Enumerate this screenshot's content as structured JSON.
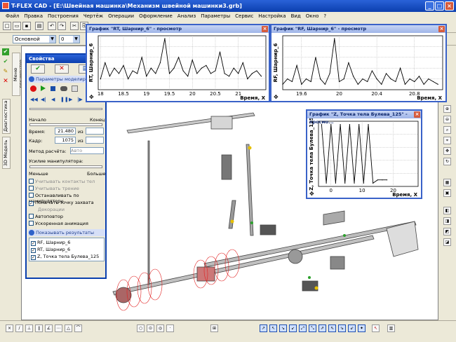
{
  "window": {
    "title": "T-FLEX CAD - [E:\\Швейная машинка\\Механизм швейной машинки3.grb]"
  },
  "menu": [
    "Файл",
    "Правка",
    "Построения",
    "Чертёж",
    "Операции",
    "Оформление",
    "Анализ",
    "Параметры",
    "Сервис",
    "Настройка",
    "Вид",
    "Окно",
    "?"
  ],
  "toolbar": {
    "view_combo": "Основной",
    "number_combo": "0",
    "scale_value": "1"
  },
  "left_tabs": [
    "Меню документов",
    "Диагностика",
    "3D Модель"
  ],
  "properties": {
    "title": "Свойства",
    "section_params": "Параметры моделирования",
    "start_label": "Начало",
    "end_label": "Конец",
    "time_label": "Время:",
    "time_value": "21.480",
    "time_of": "из",
    "frame_label": "Кадр:",
    "frame_value": "1075",
    "frame_of": "из",
    "method_label": "Метод расчёта:",
    "method_value": "Авто",
    "force_label": "Усилие манипулятора:",
    "less_label": "Меньше",
    "more_label": "Больше",
    "options": [
      {
        "label": "Учитывать контакты тел",
        "checked": false,
        "disabled": true
      },
      {
        "label": "Учитывать трение",
        "checked": false,
        "disabled": true
      },
      {
        "label": "Останавливать по манипулятору",
        "checked": false,
        "disabled": false
      },
      {
        "label": "Помечать точку захвата",
        "checked": true,
        "disabled": false
      },
      {
        "label": "Декорации",
        "checked": false,
        "disabled": true,
        "header": true
      },
      {
        "label": "Автоповтор",
        "checked": false,
        "disabled": false
      },
      {
        "label": "Ускоренная анимация",
        "checked": false,
        "disabled": false
      }
    ],
    "section_results": "Показывать результаты",
    "results": [
      {
        "label": "RF, Шарнир_6",
        "checked": true
      },
      {
        "label": "RT, Шарнир_6",
        "checked": true
      },
      {
        "label": "Z, Точка тела Булева_125",
        "checked": true
      }
    ]
  },
  "graphs": [
    {
      "id": "rt",
      "title": "График \"RT, Шарнир_6\" - просмотр",
      "ylabel": "RT, Шарнир_6",
      "xlabel": "Время, Х",
      "ticks": [
        "18",
        "18.5",
        "19",
        "19.5",
        "20",
        "20.5",
        "21"
      ]
    },
    {
      "id": "rf",
      "title": "График \"RF, Шарнир_6\" - просмотр",
      "ylabel": "RF, Шарнир_6",
      "xlabel": "Время, Х",
      "ticks": [
        "19.6",
        "20",
        "20.4",
        "20.8"
      ]
    },
    {
      "id": "z",
      "title": "График \"Z, Точка тела Булева_125\" - просмо...",
      "ylabel": "Z, Точка тела Булева_125",
      "xlabel": "Время, Х",
      "ticks": [
        "0",
        "10",
        "20"
      ]
    }
  ],
  "chart_data": [
    {
      "type": "line",
      "title": "График \"RT, Шарнир_6\" - просмотр",
      "xlabel": "Время, Х",
      "ylabel": "RT, Шарнир_6",
      "xlim": [
        17.95,
        21.6
      ],
      "x_ticks": [
        18,
        18.5,
        19,
        19.5,
        20,
        20.5,
        21
      ],
      "x": [
        18.0,
        18.1,
        18.2,
        18.3,
        18.4,
        18.5,
        18.6,
        18.7,
        18.8,
        18.9,
        19.0,
        19.1,
        19.2,
        19.3,
        19.4,
        19.5,
        19.6,
        19.7,
        19.8,
        19.9,
        20.0,
        20.1,
        20.2,
        20.3,
        20.4,
        20.5,
        20.6,
        20.7,
        20.8,
        20.9,
        21.0,
        21.1,
        21.2,
        21.3,
        21.4,
        21.5
      ],
      "y": [
        0.2,
        0.5,
        0.25,
        0.4,
        0.3,
        0.45,
        0.2,
        0.35,
        0.3,
        0.6,
        0.25,
        0.4,
        0.3,
        0.5,
        0.95,
        0.3,
        0.4,
        0.6,
        0.35,
        0.25,
        0.55,
        0.3,
        0.4,
        0.45,
        0.3,
        0.35,
        0.7,
        0.3,
        0.25,
        0.4,
        0.3,
        0.5,
        0.2,
        0.3,
        0.35,
        0.25
      ]
    },
    {
      "type": "line",
      "title": "График \"RF, Шарнир_6\" - просмотр",
      "xlabel": "Время, Х",
      "ylabel": "RF, Шарнир_6",
      "xlim": [
        19.4,
        21.1
      ],
      "x_ticks": [
        19.6,
        20,
        20.4,
        20.8
      ],
      "x": [
        19.4,
        19.45,
        19.5,
        19.55,
        19.6,
        19.65,
        19.7,
        19.75,
        19.8,
        19.85,
        19.9,
        19.95,
        20.0,
        20.05,
        20.1,
        20.15,
        20.2,
        20.25,
        20.3,
        20.35,
        20.4,
        20.45,
        20.5,
        20.55,
        20.6,
        20.65,
        20.7,
        20.75,
        20.8,
        20.85,
        20.9,
        20.95,
        21.0,
        21.05
      ],
      "y": [
        0.1,
        0.2,
        0.15,
        0.45,
        0.1,
        0.2,
        0.15,
        0.6,
        0.2,
        0.1,
        0.3,
        0.95,
        0.15,
        0.2,
        0.5,
        0.25,
        0.1,
        0.2,
        0.15,
        0.35,
        0.2,
        0.1,
        0.3,
        0.2,
        0.15,
        0.4,
        0.1,
        0.2,
        0.15,
        0.25,
        0.1,
        0.2,
        0.15,
        0.1
      ]
    },
    {
      "type": "line",
      "title": "График \"Z, Точка тела Булева_125\" - просмо...",
      "xlabel": "Время, Х",
      "ylabel": "Z, Точка тела Булева_125",
      "xlim": [
        -4,
        28
      ],
      "x_ticks": [
        0,
        10,
        20
      ],
      "x": [
        -3,
        -1.5,
        0,
        1.5,
        3,
        4.5,
        6,
        7.5,
        9,
        10.5,
        12,
        13.5,
        15,
        16.5,
        18
      ],
      "y": [
        0.95,
        0.05,
        0.95,
        0.05,
        0.95,
        0.05,
        0.95,
        0.05,
        0.95,
        0.05,
        0.95,
        0.05,
        0.1,
        0.1,
        0.1
      ]
    }
  ]
}
